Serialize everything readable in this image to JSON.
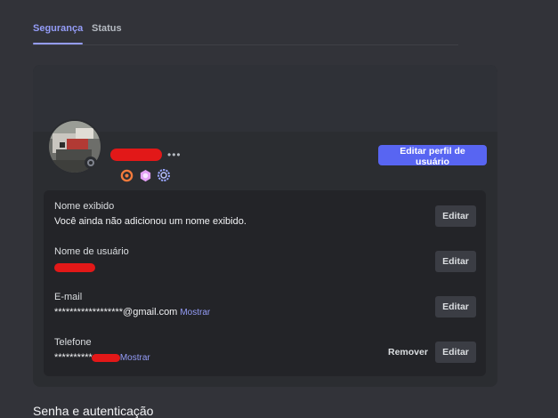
{
  "tabs": [
    {
      "label": "Segurança",
      "active": true
    },
    {
      "label": "Status",
      "active": false
    }
  ],
  "profile": {
    "username": "",
    "edit_profile_label": "Editar perfil de usuário",
    "status": "offline",
    "badges": [
      "hypesquad-balance-badge",
      "nitro-badge",
      "server-boost-badge"
    ]
  },
  "fields": {
    "display_name": {
      "label": "Nome exibido",
      "value": "Você ainda não adicionou um nome exibido.",
      "edit_label": "Editar"
    },
    "username": {
      "label": "Nome de usuário",
      "value": "",
      "edit_label": "Editar"
    },
    "email": {
      "label": "E-mail",
      "value": "******************@gmail.com",
      "reveal_label": "Mostrar",
      "edit_label": "Editar"
    },
    "phone": {
      "label": "Telefone",
      "value": "**********",
      "reveal_label": "Mostrar",
      "remove_label": "Remover",
      "edit_label": "Editar"
    }
  },
  "next_section": {
    "heading": "Senha e autenticação"
  },
  "colors": {
    "accent": "#5865f2",
    "link": "#949cf7",
    "redaction": "#e21818",
    "background": "#323339",
    "card": "#2b2d31",
    "field_panel": "#232428"
  }
}
